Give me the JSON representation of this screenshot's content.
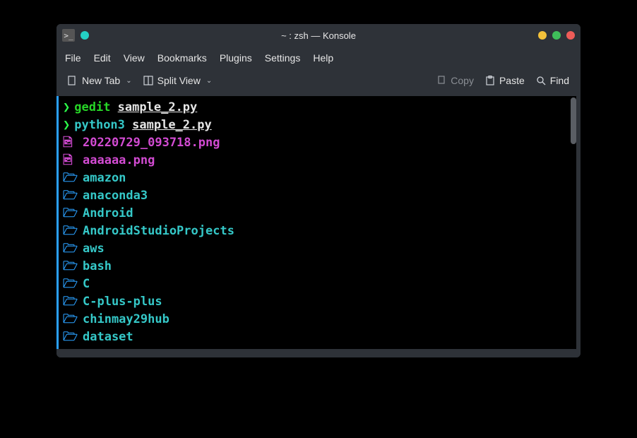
{
  "window": {
    "title": "~ : zsh — Konsole"
  },
  "menubar": {
    "items": [
      "File",
      "Edit",
      "View",
      "Bookmarks",
      "Plugins",
      "Settings",
      "Help"
    ]
  },
  "toolbar": {
    "new_tab": "New Tab",
    "split_view": "Split View",
    "copy": "Copy",
    "paste": "Paste",
    "find": "Find"
  },
  "terminal": {
    "history": [
      {
        "prompt": "❯",
        "cmd": "gedit",
        "cmd_color": "green",
        "arg": "sample_2",
        "ext": ".py"
      },
      {
        "prompt": "❯",
        "cmd": "python3",
        "cmd_color": "cyan",
        "arg": "sample_2",
        "ext": ".py"
      }
    ],
    "listing": [
      {
        "type": "file",
        "name": "20220729_093718.png",
        "color": "magenta"
      },
      {
        "type": "file",
        "name": "aaaaaa.png",
        "color": "magenta"
      },
      {
        "type": "folder",
        "name": "amazon",
        "color": "cyan"
      },
      {
        "type": "folder",
        "name": "anaconda3",
        "color": "cyan"
      },
      {
        "type": "folder",
        "name": "Android",
        "color": "cyan"
      },
      {
        "type": "folder",
        "name": "AndroidStudioProjects",
        "color": "cyan"
      },
      {
        "type": "folder",
        "name": "aws",
        "color": "cyan"
      },
      {
        "type": "folder",
        "name": "bash",
        "color": "cyan"
      },
      {
        "type": "folder",
        "name": "C",
        "color": "cyan"
      },
      {
        "type": "folder",
        "name": "C-plus-plus",
        "color": "cyan"
      },
      {
        "type": "folder",
        "name": "chinmay29hub",
        "color": "cyan"
      },
      {
        "type": "folder",
        "name": "dataset",
        "color": "cyan"
      }
    ]
  },
  "icons": {
    "file_glyph": "🖻",
    "folder_glyph": "🗁"
  }
}
